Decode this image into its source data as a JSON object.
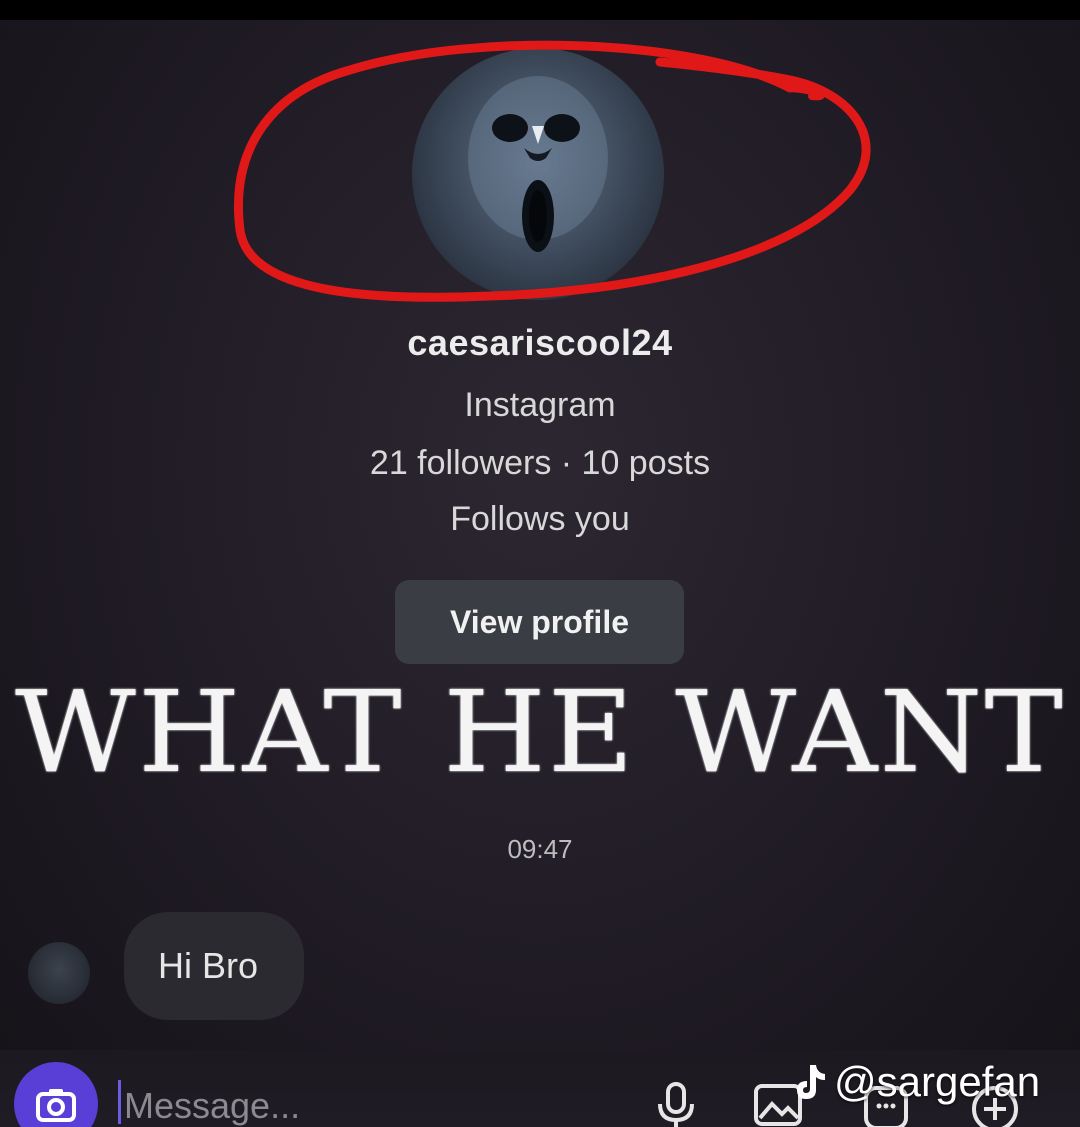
{
  "profile": {
    "username": "caesariscool24",
    "platform": "Instagram",
    "stats": "21 followers · 10 posts",
    "follow_status": "Follows you",
    "view_profile_label": "View profile"
  },
  "caption": "WHAT HE WANT",
  "chat": {
    "timestamp": "09:47",
    "messages": [
      {
        "text": "Hi Bro",
        "sender": "them"
      }
    ]
  },
  "composer": {
    "placeholder": "Message...",
    "icons": [
      "camera-icon",
      "microphone-icon",
      "gallery-icon",
      "sticker-icon",
      "plus-icon"
    ]
  },
  "watermark": {
    "handle": "@sargefan",
    "icon": "tiktok-icon"
  },
  "colors": {
    "annotation_red": "#e01818",
    "camera_button": "#5a3fd6",
    "background": "#221d27"
  }
}
